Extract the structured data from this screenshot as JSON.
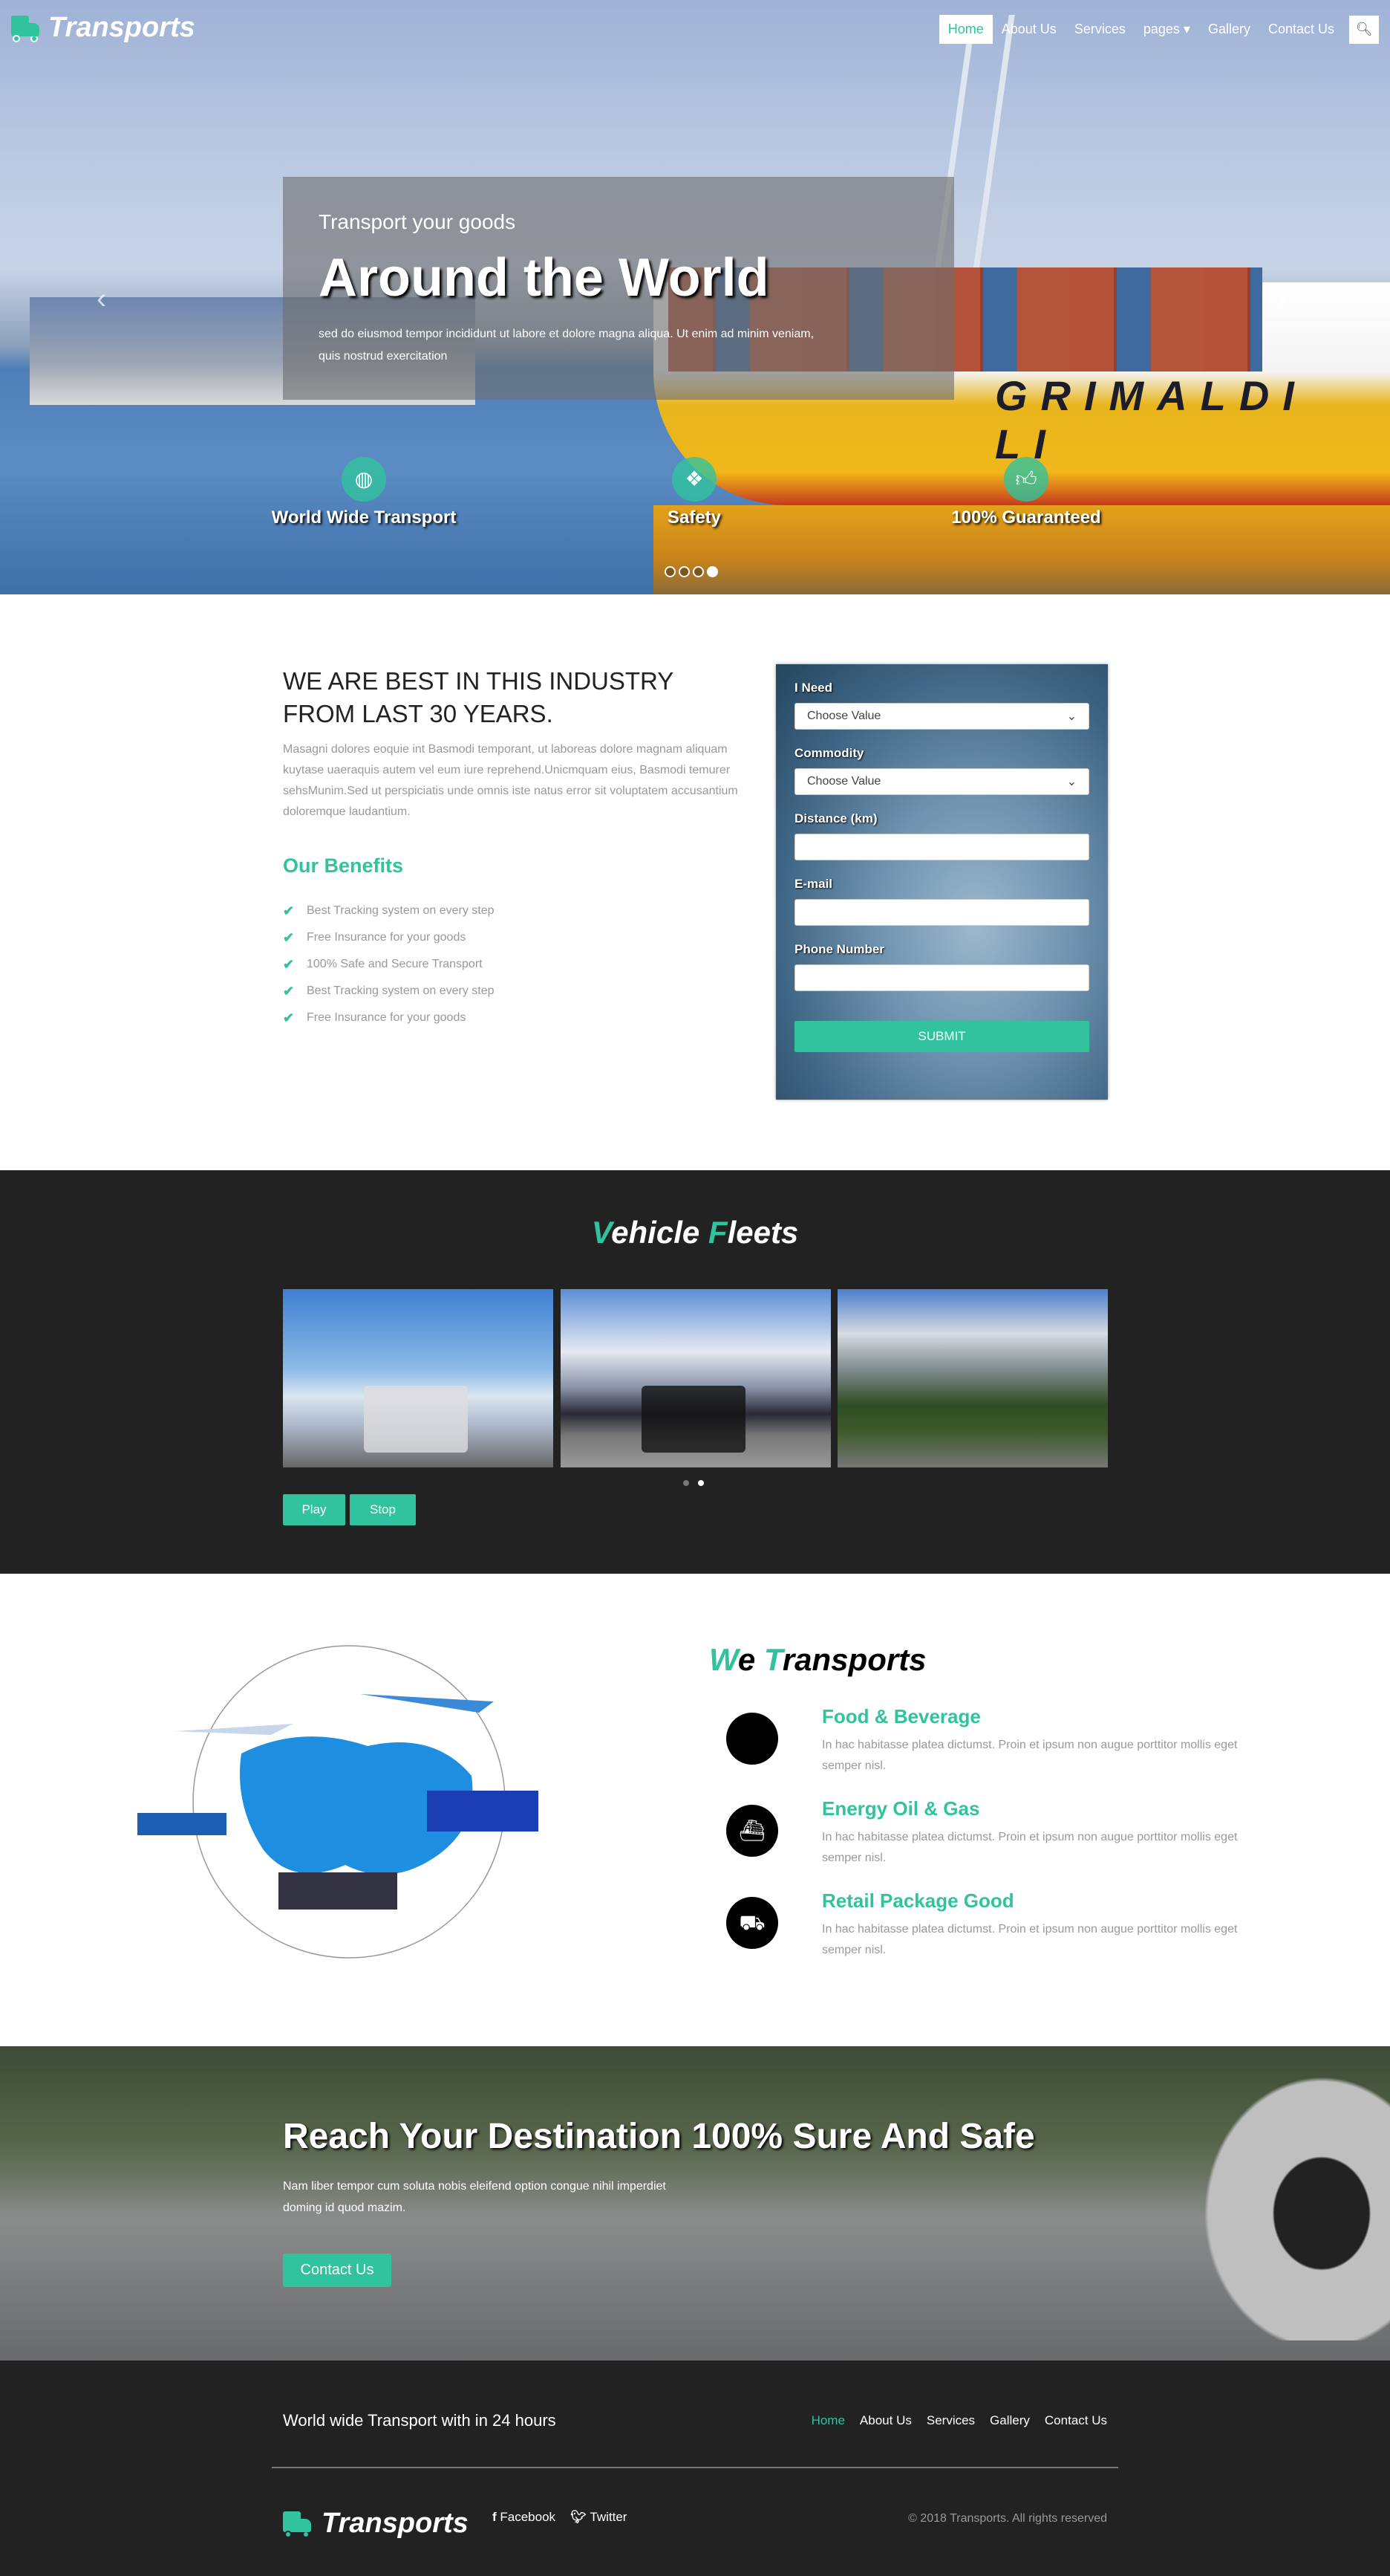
{
  "brand": {
    "name": "Transports",
    "accent": "#30c39e",
    "dark": "#222222"
  },
  "nav": {
    "items": [
      {
        "label": "Home",
        "active": true
      },
      {
        "label": "About Us"
      },
      {
        "label": "Services"
      },
      {
        "label": "pages ▾"
      },
      {
        "label": "Gallery"
      },
      {
        "label": "Contact Us"
      }
    ],
    "search_icon": "search-icon"
  },
  "hero": {
    "subtitle": "Transport your goods",
    "title": "Around the World",
    "text": "sed do eiusmod tempor incididunt ut labore et dolore magna aliqua. Ut enim ad minim veniam, quis nostrud exercitation",
    "ship_text": "GRIMALDI LI",
    "features": [
      {
        "label": "World Wide Transport",
        "icon": "globe-icon"
      },
      {
        "label": "Safety",
        "icon": "dropbox-icon"
      },
      {
        "label": "100% Guaranteed",
        "icon": "thumbs-up-icon"
      }
    ],
    "slides": 4,
    "active_slide": 4
  },
  "about": {
    "heading": "We are best in this industry from last 30 years.",
    "text": "Masagni dolores eoquie int Basmodi temporant, ut laboreas dolore magnam aliquam kuytase uaeraquis autem vel eum iure reprehend.Unicmquam eius, Basmodi temurer sehsMunim.Sed ut perspiciatis unde omnis iste natus error sit voluptatem accusantium doloremque laudantium.",
    "benefits_title": "Our Benefits",
    "benefits": [
      "Best Tracking system on every step",
      "Free Insurance for your goods",
      "100% Safe and Secure Transport",
      "Best Tracking system on every step",
      "Free Insurance for your goods"
    ]
  },
  "form": {
    "need_label": "I Need",
    "need_value": "Choose Value",
    "commodity_label": "Commodity",
    "commodity_value": "Choose Value",
    "distance_label": "Distance (km)",
    "distance_value": "",
    "email_label": "E-mail",
    "email_value": "",
    "phone_label": "Phone Number",
    "phone_value": "",
    "submit": "SUBMIT"
  },
  "fleets": {
    "title_first_letter": "V",
    "title_rest1": "ehicle ",
    "title_second_letter": "F",
    "title_rest2": "leets",
    "play": "Play",
    "stop": "Stop",
    "dots": 2,
    "active_dot": 2
  },
  "we_transports": {
    "title_w": "W",
    "title_e": "e ",
    "title_t": "T",
    "title_rest": "ransports",
    "services": [
      {
        "title": "Food & Beverage",
        "icon": "apple-icon",
        "text": "In hac habitasse platea dictumst. Proin et ipsum non augue porttitor mollis eget semper nisl."
      },
      {
        "title": "Energy Oil & Gas",
        "icon": "ship-icon",
        "text": "In hac habitasse platea dictumst. Proin et ipsum non augue porttitor mollis eget semper nisl."
      },
      {
        "title": "Retail Package Good",
        "icon": "dolly-icon",
        "text": "In hac habitasse platea dictumst. Proin et ipsum non augue porttitor mollis eget semper nisl."
      }
    ]
  },
  "cta": {
    "title": "Reach Your Destination 100% Sure And Safe",
    "text": "Nam liber tempor cum soluta nobis eleifend option congue nihil imperdiet doming id quod mazim.",
    "button": "Contact Us"
  },
  "footer": {
    "tagline": "World wide Transport with in 24 hours",
    "nav": [
      "Home",
      "About Us",
      "Services",
      "Gallery",
      "Contact Us"
    ],
    "facebook": "Facebook",
    "twitter": "Twitter",
    "copyright": "© 2018 Transports. All rights reserved"
  }
}
